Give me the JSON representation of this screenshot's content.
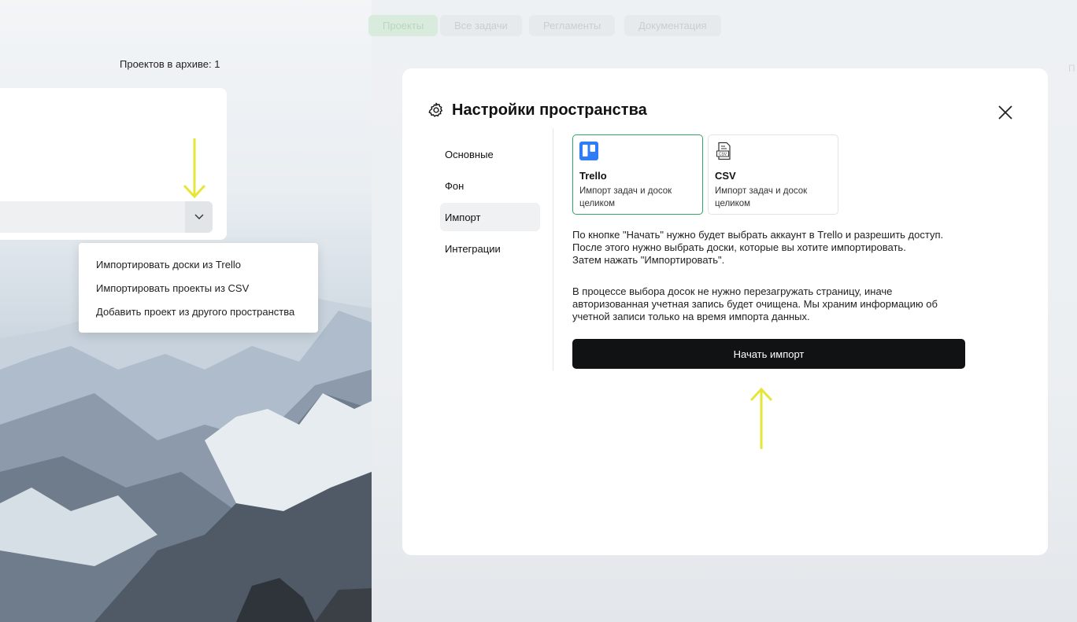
{
  "background": {
    "archive_label": "Проектов в архиве: 1",
    "nav_tabs": [
      "Проекты",
      "Все задачи",
      "Регламенты",
      "Документация"
    ],
    "corner_text": "П"
  },
  "import_menu": {
    "items": [
      "Импортировать доски из Trello",
      "Импортировать проекты из CSV",
      "Добавить проект из другого пространства"
    ]
  },
  "modal": {
    "title": "Настройки пространства",
    "nav": [
      "Основные",
      "Фон",
      "Импорт",
      "Интеграции"
    ],
    "active_nav": "Импорт",
    "sources": [
      {
        "name": "Trello",
        "description": "Импорт задач и досок целиком",
        "icon": "trello-icon",
        "selected": true
      },
      {
        "name": "CSV",
        "description": "Импорт задач и досок целиком",
        "icon": "csv-file-icon",
        "selected": false
      }
    ],
    "paragraph1": "По кнопке \"Начать\" нужно будет выбрать аккаунт в Trello и разрешить доступ.\nПосле этого нужно выбрать доски, которые вы хотите импортировать.\nЗатем нажать \"Импортировать\".",
    "paragraph2": "В процессе выбора досок не нужно перезагружать страницу, иначе авторизованная учетная запись будет очищена. Мы храним информацию об учетной записи только на время импорта данных.",
    "start_button": "Начать импорт"
  },
  "colors": {
    "accent_green": "#2fa862",
    "button_dark": "#111213",
    "annotation_arrow": "#e6e63a",
    "trello_blue": "#2f7cf6"
  }
}
